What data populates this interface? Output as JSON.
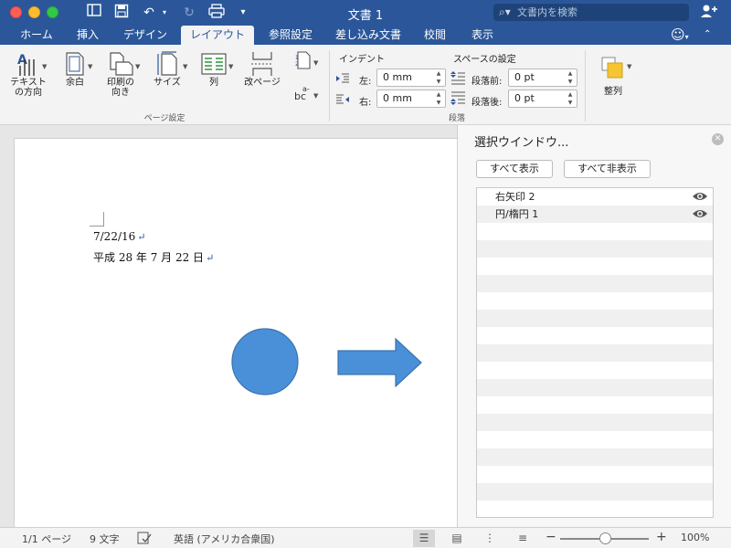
{
  "window": {
    "title": "文書 1",
    "search_placeholder": "文書内を検索"
  },
  "tabs": [
    {
      "label": "ホーム"
    },
    {
      "label": "挿入"
    },
    {
      "label": "デザイン"
    },
    {
      "label": "レイアウト"
    },
    {
      "label": "参照設定"
    },
    {
      "label": "差し込み文書"
    },
    {
      "label": "校閲"
    },
    {
      "label": "表示"
    }
  ],
  "ribbon": {
    "page_setup": {
      "buttons": [
        {
          "label": "テキスト\nの方向"
        },
        {
          "label": "余白"
        },
        {
          "label": "印刷の\n向き"
        },
        {
          "label": "サイズ"
        },
        {
          "label": "列"
        },
        {
          "label": "改ページ"
        }
      ],
      "group_label": "ページ設定"
    },
    "indent": {
      "title": "インデント",
      "left_label": "左:",
      "left_value": "0 mm",
      "right_label": "右:",
      "right_value": "0 mm"
    },
    "spacing": {
      "title": "スペースの設定",
      "before_label": "段落前:",
      "before_value": "0 pt",
      "after_label": "段落後:",
      "after_value": "0 pt"
    },
    "paragraph_group_label": "段落",
    "arrange": {
      "label": "整列"
    }
  },
  "document": {
    "lines": [
      "7/22/16",
      "平成 28 年 7 月 22 日"
    ],
    "return_mark": "↵"
  },
  "selection_pane": {
    "title": "選択ウインドウ...",
    "show_all": "すべて表示",
    "hide_all": "すべて非表示",
    "items": [
      {
        "label": "右矢印 2"
      },
      {
        "label": "円/楕円 1"
      }
    ]
  },
  "status": {
    "page": "1/1 ページ",
    "words": "9 文字",
    "language": "英語 (アメリカ合衆国)",
    "zoom": "100%"
  },
  "colors": {
    "accent": "#2b579a",
    "shape_fill": "#4a90d9",
    "shape_stroke": "#3b73b0"
  }
}
